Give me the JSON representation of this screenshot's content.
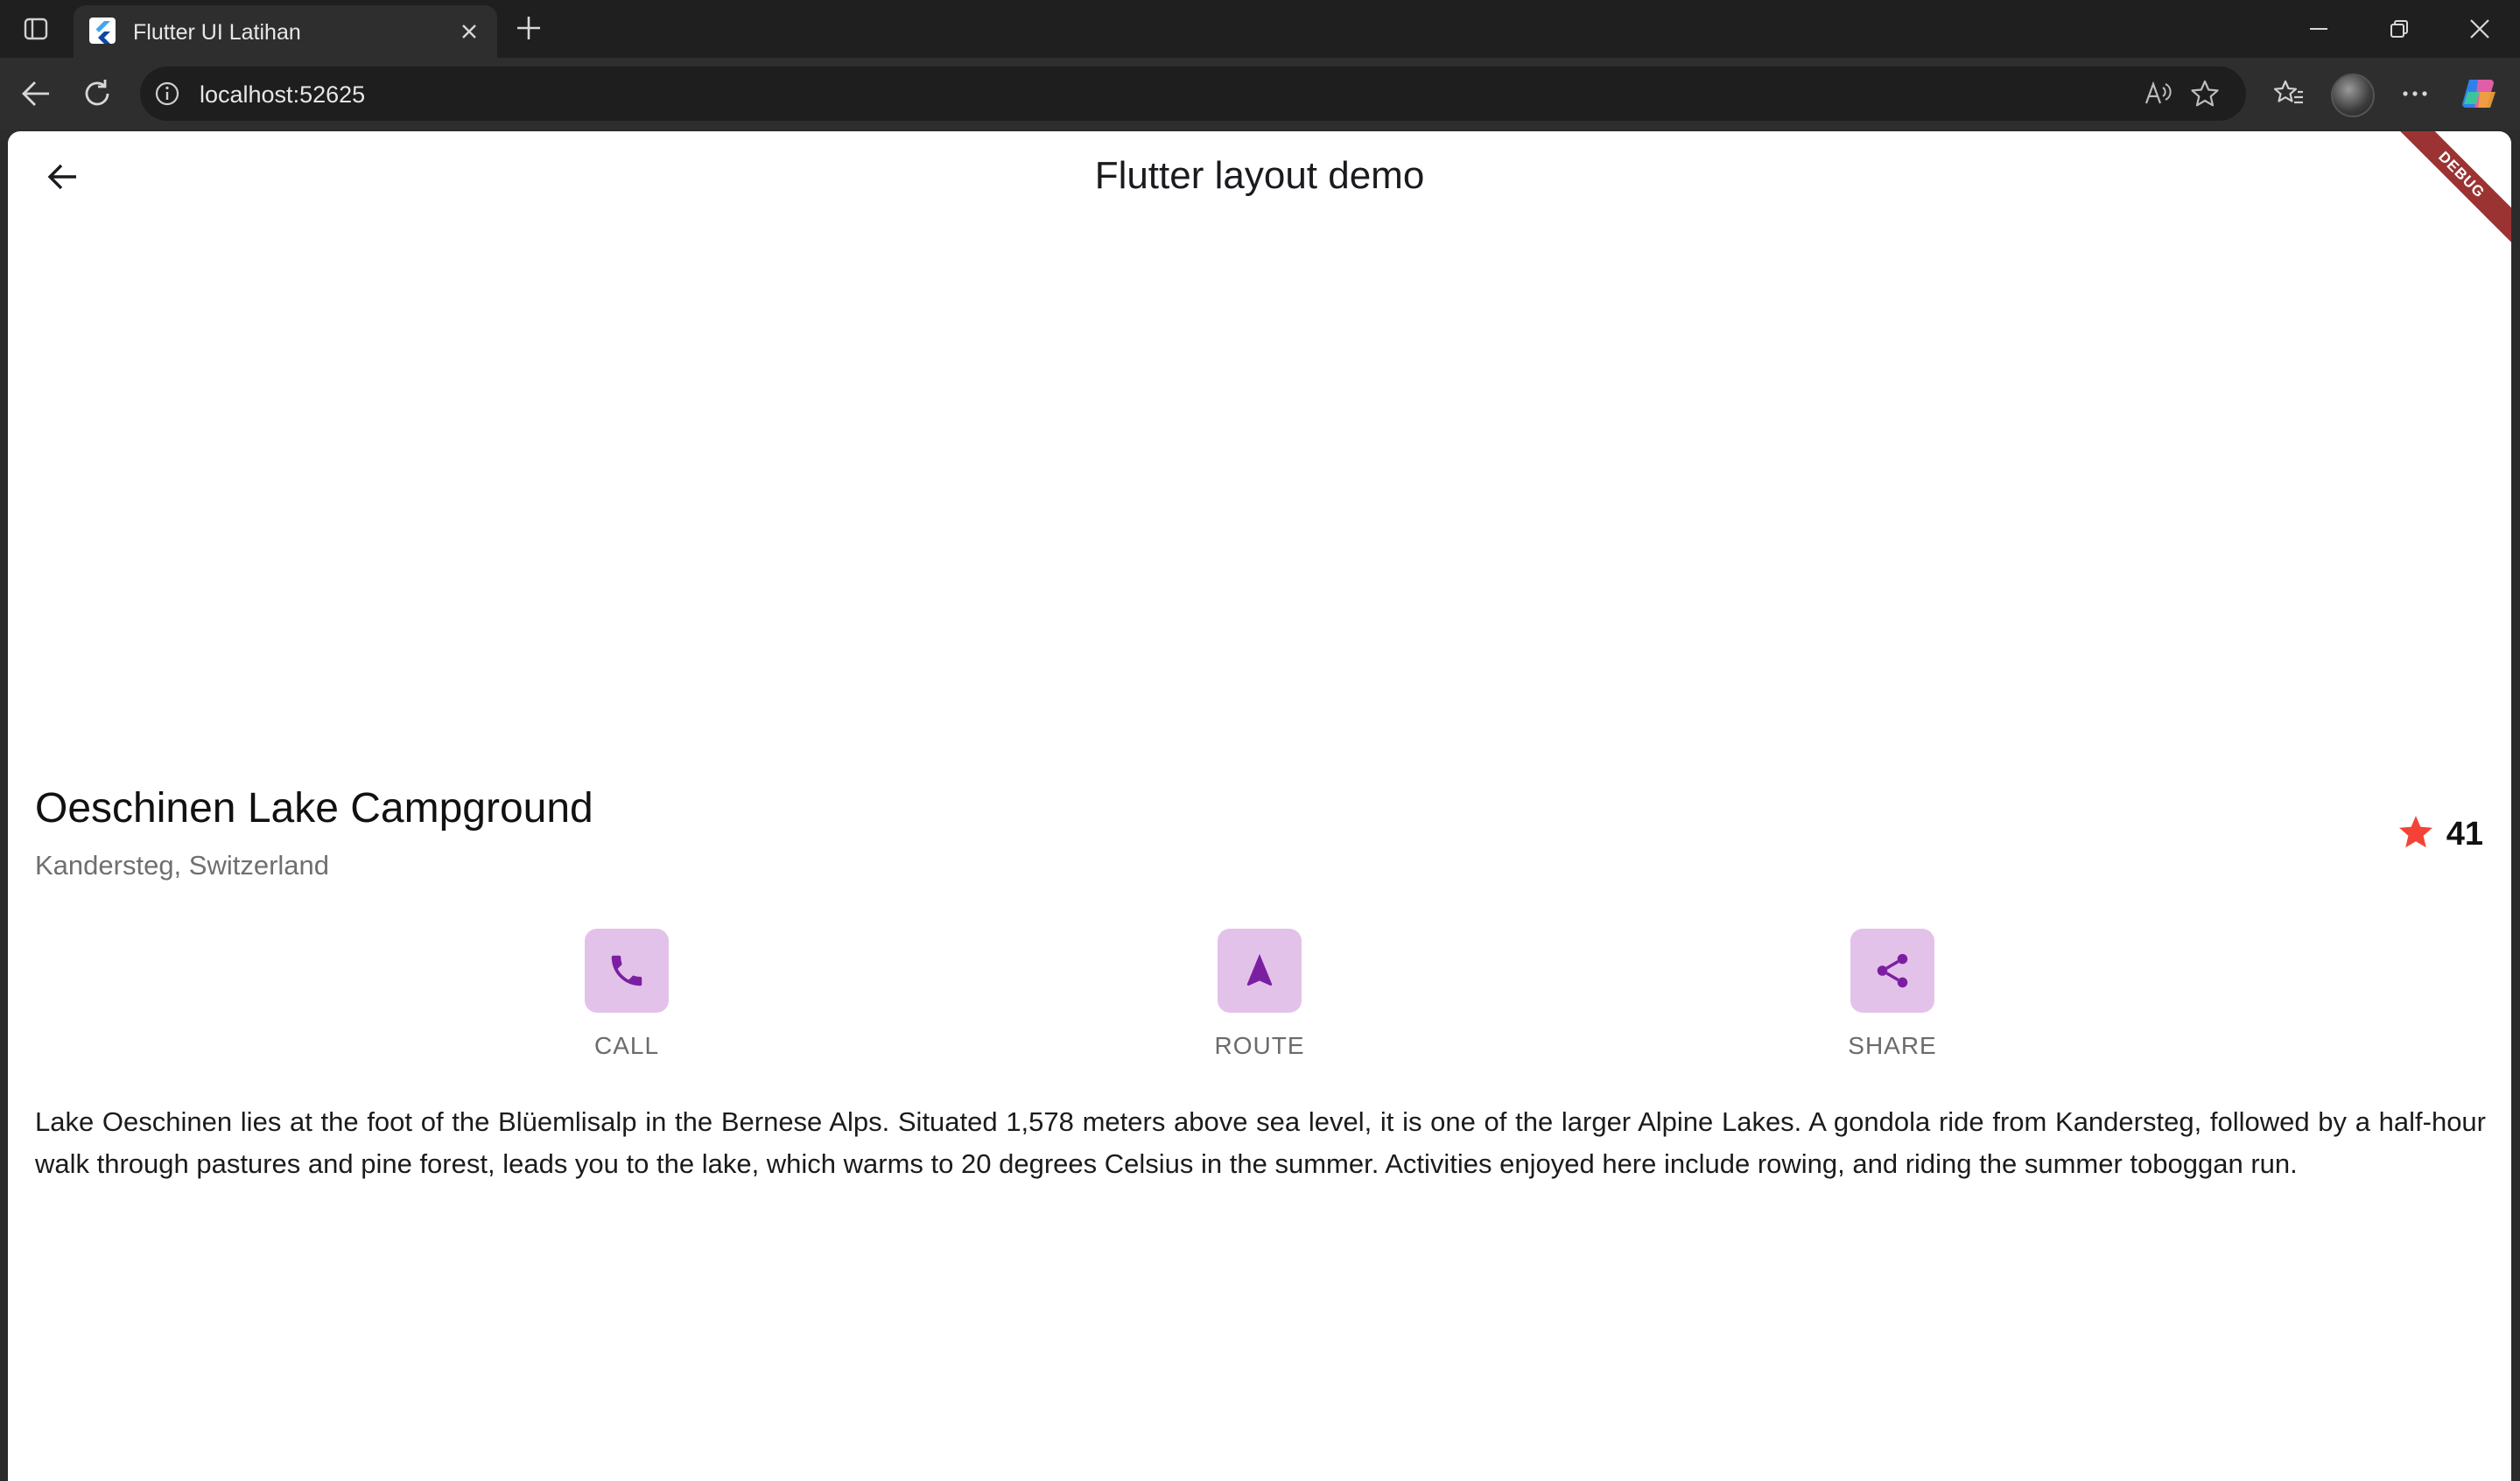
{
  "browser": {
    "tab_title": "Flutter UI Latihan",
    "url": "localhost:52625"
  },
  "app": {
    "title": "Flutter layout demo",
    "debug_banner": "DEBUG",
    "place_title": "Oeschinen Lake Campground",
    "place_subtitle": "Kandersteg, Switzerland",
    "rating_count": "41",
    "accent_color": "#7b1fa2",
    "star_color": "#f44336",
    "actions": [
      {
        "label": "CALL",
        "icon": "phone-icon"
      },
      {
        "label": "ROUTE",
        "icon": "navigation-icon"
      },
      {
        "label": "SHARE",
        "icon": "share-icon"
      }
    ],
    "description": "Lake Oeschinen lies at the foot of the Blüemlisalp in the Bernese Alps. Situated 1,578 meters above sea level, it is one of the larger Alpine Lakes. A gondola ride from Kandersteg, followed by a half-hour walk through pastures and pine forest, leads you to the lake, which warms to 20 degrees Celsius in the summer. Activities enjoyed here include rowing, and riding the summer toboggan run."
  }
}
